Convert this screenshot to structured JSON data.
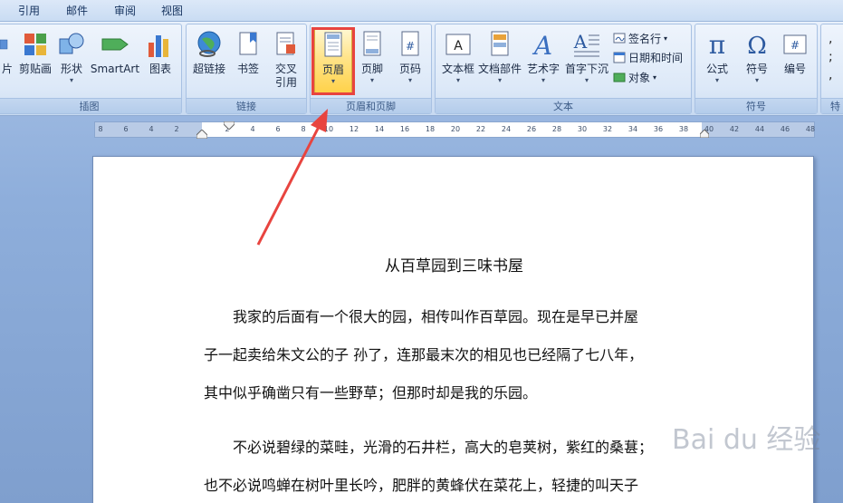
{
  "tabs": [
    "引用",
    "邮件",
    "审阅",
    "视图"
  ],
  "groups": {
    "illustrations": {
      "label": "插图",
      "buttons": [
        "片",
        "剪贴画",
        "形状",
        "SmartArt",
        "图表"
      ]
    },
    "links": {
      "label": "链接",
      "buttons": [
        "超链接",
        "书签",
        "交叉\n引用"
      ]
    },
    "header_footer": {
      "label": "页眉和页脚",
      "buttons": [
        "页眉",
        "页脚",
        "页码"
      ]
    },
    "text": {
      "label": "文本",
      "buttons": [
        "文本框",
        "文档部件",
        "艺术字",
        "首字下沉"
      ],
      "small": [
        "签名行",
        "日期和时间",
        "对象"
      ]
    },
    "symbols": {
      "label": "符号",
      "buttons": [
        "公式",
        "符号",
        "编号"
      ]
    },
    "special": {
      "label": "特"
    }
  },
  "ruler_ticks": [
    "8",
    "6",
    "4",
    "2",
    "",
    "2",
    "4",
    "6",
    "8",
    "10",
    "12",
    "14",
    "16",
    "18",
    "20",
    "22",
    "24",
    "26",
    "28",
    "30",
    "32",
    "34",
    "36",
    "38",
    "40",
    "42",
    "44",
    "46",
    "48"
  ],
  "document": {
    "title": "从百草园到三味书屋",
    "para1": [
      "我家的后面有一个很大的园，相传叫作百草园。现在是早已并屋",
      "子一起卖给朱文公的子 孙了，连那最末次的相见也已经隔了七八年，",
      "其中似乎确凿只有一些野草；但那时却是我的乐园。"
    ],
    "para2": [
      "不必说碧绿的菜畦，光滑的石井栏，高大的皂荚树，紫红的桑葚；",
      "也不必说鸣蝉在树叶里长吟，肥胖的黄蜂伏在菜花上，轻捷的叫天子"
    ]
  },
  "watermark": "Bai du 经验",
  "colors": {
    "highlight": "#ffd24a",
    "annotation": "#e8443f"
  }
}
